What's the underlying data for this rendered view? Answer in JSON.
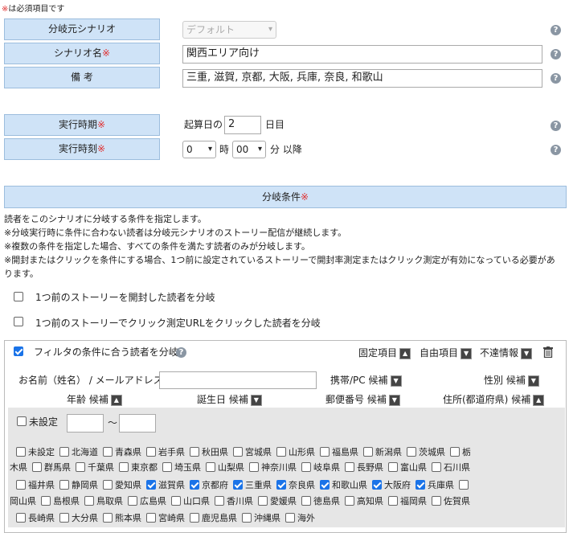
{
  "required_note": {
    "mark": "※",
    "text": "は必須項目です"
  },
  "form": {
    "source_scenario": {
      "label": "分岐元シナリオ",
      "value": "デフォルト"
    },
    "scenario_name": {
      "label": "シナリオ名",
      "required_mark": "※",
      "value": "関西エリア向け"
    },
    "remarks": {
      "label": "備 考",
      "value": "三重, 滋賀, 京都, 大阪, 兵庫, 奈良, 和歌山"
    },
    "exec_period": {
      "label": "実行時期",
      "required_mark": "※",
      "prefix": "起算日の",
      "value": "2",
      "suffix": "日目"
    },
    "exec_time": {
      "label": "実行時刻",
      "required_mark": "※",
      "hour": "0",
      "hour_unit": "時",
      "minute": "00",
      "minute_unit": "分 以降"
    }
  },
  "branch": {
    "header": "分岐条件",
    "required_mark": "※",
    "desc": [
      "読者をこのシナリオに分岐する条件を指定します。",
      "※分岐実行時に条件に合わない読者は分岐元シナリオのストーリー配信が継続します。",
      "※複数の条件を指定した場合、すべての条件を満たす読者のみが分岐します。",
      "※開封またはクリックを条件にする場合、1つ前に設定されているストーリーで開封率測定またはクリック測定が有効になっている必要があ",
      "ります。"
    ],
    "opt_opened": {
      "label": "1つ前のストーリーを開封した読者を分岐",
      "checked": false
    },
    "opt_clicked": {
      "label": "1つ前のストーリーでクリック測定URLをクリックした読者を分岐",
      "checked": false
    }
  },
  "filter": {
    "label": "フィルタの条件に合う読者を分岐",
    "checked": true,
    "fixed_items": "固定項目",
    "free_items": "自由項目",
    "invalid_info": "不達情報",
    "name_email": "お名前（姓名） / メールアドレス",
    "mobile_pc": "携帯/PC",
    "gender": "性別",
    "age": "年齢",
    "birthday": "誕生日",
    "postal": "郵便番号",
    "address": "住所(都道府県)",
    "candidate": "候補",
    "unset": "未設定",
    "tilde": "～"
  },
  "prefectures": [
    [
      [
        "未設定",
        false
      ],
      [
        "北海道",
        false
      ],
      [
        "青森県",
        false
      ],
      [
        "岩手県",
        false
      ],
      [
        "秋田県",
        false
      ],
      [
        "宮城県",
        false
      ],
      [
        "山形県",
        false
      ],
      [
        "福島県",
        false
      ],
      [
        "新潟県",
        false
      ],
      [
        "茨城県",
        false
      ],
      [
        "栃",
        false
      ]
    ],
    [
      [
        "木県",
        null
      ],
      [
        "群馬県",
        false
      ],
      [
        "千葉県",
        false
      ],
      [
        "東京都",
        false
      ],
      [
        "埼玉県",
        false
      ],
      [
        "山梨県",
        false
      ],
      [
        "神奈川県",
        false
      ],
      [
        "岐阜県",
        false
      ],
      [
        "長野県",
        false
      ],
      [
        "富山県",
        false
      ],
      [
        "石川県",
        false
      ]
    ],
    [
      [
        "福井県",
        false
      ],
      [
        "静岡県",
        false
      ],
      [
        "愛知県",
        false
      ],
      [
        "滋賀県",
        true
      ],
      [
        "京都府",
        true
      ],
      [
        "三重県",
        true
      ],
      [
        "奈良県",
        true
      ],
      [
        "和歌山県",
        true
      ],
      [
        "大阪府",
        true
      ],
      [
        "兵庫県",
        true
      ],
      [
        "",
        false
      ]
    ],
    [
      [
        "岡山県",
        null
      ],
      [
        "島根県",
        false
      ],
      [
        "鳥取県",
        false
      ],
      [
        "広島県",
        false
      ],
      [
        "山口県",
        false
      ],
      [
        "香川県",
        false
      ],
      [
        "愛媛県",
        false
      ],
      [
        "徳島県",
        false
      ],
      [
        "高知県",
        false
      ],
      [
        "福岡県",
        false
      ],
      [
        "佐賀県",
        false
      ]
    ],
    [
      [
        "長崎県",
        false
      ],
      [
        "大分県",
        false
      ],
      [
        "熊本県",
        false
      ],
      [
        "宮崎県",
        false
      ],
      [
        "鹿児島県",
        false
      ],
      [
        "沖縄県",
        false
      ],
      [
        "海外",
        false
      ]
    ]
  ]
}
